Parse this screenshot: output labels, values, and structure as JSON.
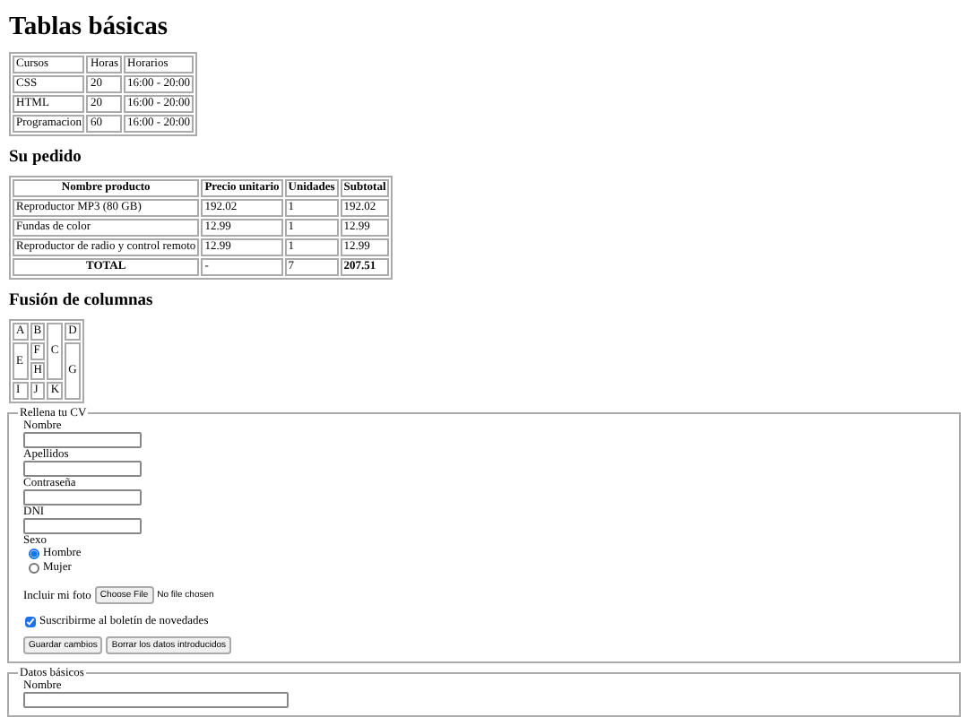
{
  "basic_heading": "Tablas básicas",
  "basic_table": {
    "columns": [
      "Cursos",
      "Horas",
      "Horarios"
    ],
    "rows": [
      [
        "CSS",
        "20",
        "16:00 - 20:00"
      ],
      [
        "HTML",
        "20",
        "16:00 - 20:00"
      ],
      [
        "Programacion",
        "60",
        "16:00 - 20:00"
      ]
    ]
  },
  "order_heading": "Su pedido",
  "order_table": {
    "columns": [
      "Nombre producto",
      "Precio unitario",
      "Unidades",
      "Subtotal"
    ],
    "rows": [
      [
        "Reproductor MP3 (80 GB)",
        "192.02",
        "1",
        "192.02"
      ],
      [
        "Fundas de color",
        "12.99",
        "1",
        "12.99"
      ],
      [
        "Reproductor de radio y control remoto",
        "12.99",
        "1",
        "12.99"
      ]
    ],
    "total": [
      "TOTAL",
      "-",
      "7",
      "207.51"
    ]
  },
  "merge_heading": "Fusión de columnas",
  "merge_table": [
    [
      "A",
      "B",
      "C",
      "D"
    ],
    [
      "E",
      "F",
      "G"
    ],
    [
      "H"
    ],
    [
      "I",
      "J",
      "K"
    ]
  ],
  "cv_form": {
    "legend": "Rellena tu CV",
    "fields": [
      {
        "label": "Nombre"
      },
      {
        "label": "Apellidos"
      },
      {
        "label": "Contraseña"
      },
      {
        "label": "DNI"
      }
    ],
    "sex_label": "Sexo",
    "sex_options": [
      {
        "label": "Hombre",
        "selected": true
      },
      {
        "label": "Mujer",
        "selected": false
      }
    ],
    "photo_label": "Incluir mi foto",
    "file_button": "Choose File",
    "file_status": "No file chosen",
    "newsletter": {
      "label": "Suscribirme al boletín de novedades",
      "checked": true
    },
    "buttons": [
      "Guardar cambios",
      "Borrar los datos introducidos"
    ]
  },
  "basic_form": {
    "legend": "Datos básicos",
    "fields": [
      {
        "label": "Nombre"
      }
    ]
  }
}
